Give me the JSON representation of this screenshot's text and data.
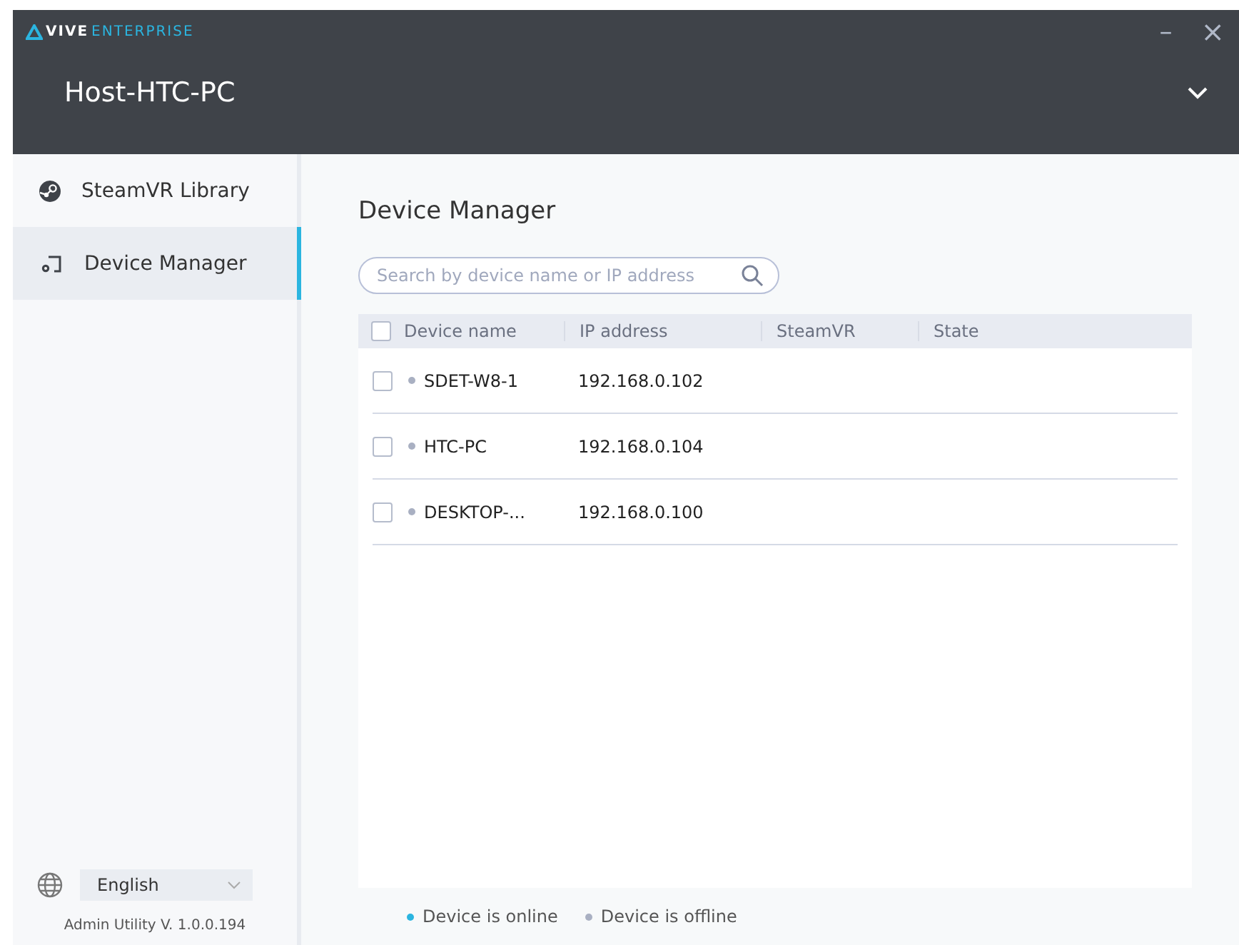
{
  "window": {
    "brand": "VIVE",
    "brand_suffix": "ENTERPRISE",
    "host": "Host-HTC-PC",
    "minimize": "–",
    "close": "×"
  },
  "sidebar": {
    "items": [
      {
        "label": "SteamVR Library",
        "kind": "steam",
        "selected": false
      },
      {
        "label": "Device Manager",
        "kind": "device",
        "selected": true
      }
    ],
    "language": "English",
    "version": "Admin Utility V. 1.0.0.194"
  },
  "main": {
    "title": "Device Manager",
    "search": {
      "placeholder": "Search by device name or IP address"
    },
    "table": {
      "select_all": false,
      "columns": [
        "Device name",
        "IP address",
        "SteamVR",
        "State"
      ],
      "rows": [
        {
          "checked": false,
          "color": "#a9b0c2",
          "name": "SDET-W8-1",
          "ip": "192.168.0.102"
        },
        {
          "checked": false,
          "color": "#a9b0c2",
          "name": "HTC-PC",
          "ip": "192.168.0.104"
        },
        {
          "checked": false,
          "color": "#a9b0c2",
          "name": "DESKTOP-...",
          "ip": "192.168.0.100"
        }
      ]
    },
    "legend": [
      {
        "color": "#2bb5e0",
        "label": "Device is online"
      },
      {
        "color": "#a9b0c2",
        "label": "Device is offline"
      }
    ]
  }
}
